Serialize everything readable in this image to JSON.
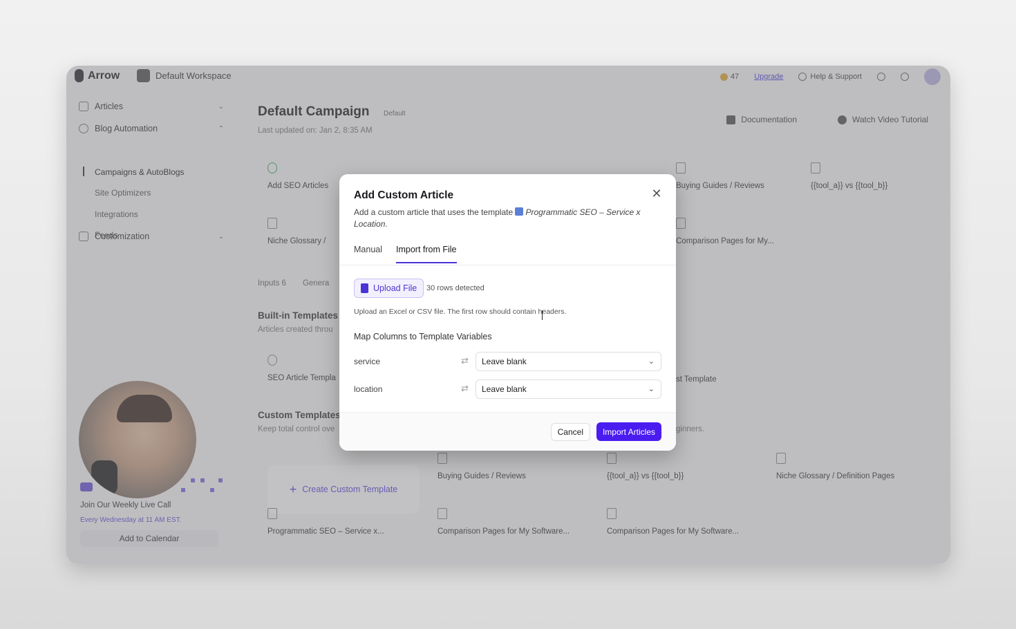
{
  "app": {
    "brand": "Arrow",
    "workspace": "Default Workspace",
    "credits": "47",
    "upgrade_label": "Upgrade",
    "help_label": "Help & Support"
  },
  "sidebar": {
    "items": [
      {
        "label": "Articles"
      },
      {
        "label": "Blog Automation"
      },
      {
        "label": "Customization"
      }
    ],
    "subitems": [
      {
        "label": "Campaigns & AutoBlogs"
      },
      {
        "label": "Site Optimizers"
      },
      {
        "label": "Integrations"
      },
      {
        "label": "Feeds"
      }
    ],
    "live": {
      "title": "Join Our Weekly Live Call",
      "subtitle": "Every Wednesday at 11 AM EST.",
      "button": "Add to Calendar"
    }
  },
  "main": {
    "title": "Default Campaign",
    "badge": "Default",
    "updated": "Last updated on: Jan 2, 8:35 AM",
    "documentation": "Documentation",
    "video_tutorial": "Watch Video Tutorial",
    "top_cards": [
      "Add SEO Articles",
      "Buying Guides / Reviews",
      "{{tool_a}} vs {{tool_b}}",
      "Niche Glossary /",
      "Comparison Pages for My..."
    ],
    "tabs": [
      "Inputs",
      "6",
      "Genera"
    ],
    "builtin_title": "Built-in Templates",
    "builtin_sub": "Articles created throu",
    "builtin_cards": [
      "SEO Article Templa",
      "st Template"
    ],
    "custom_title": "Custom Templates",
    "custom_sub": "Keep total control ove",
    "custom_sub_right": "ginners.",
    "create_template": "Create Custom Template",
    "custom_cards": [
      "Buying Guides / Reviews",
      "{{tool_a}} vs {{tool_b}}",
      "Niche Glossary / Definition Pages",
      "Programmatic SEO – Service x...",
      "Comparison Pages for My Software...",
      "Comparison Pages for My Software..."
    ]
  },
  "modal": {
    "title": "Add Custom Article",
    "desc_prefix": "Add a custom article that uses the template",
    "template_name": "Programmatic SEO – Service x Location",
    "desc_suffix": ".",
    "tabs": [
      "Manual",
      "Import from File"
    ],
    "active_tab": "Import from File",
    "upload_label": "Upload File",
    "rows_detected": "30 rows detected",
    "upload_help": "Upload an Excel or CSV file. The first row should contain headers.",
    "map_heading": "Map Columns to Template Variables",
    "mappings": [
      {
        "variable": "service",
        "value": "Leave blank"
      },
      {
        "variable": "location",
        "value": "Leave blank"
      }
    ],
    "cancel_label": "Cancel",
    "import_label": "Import Articles"
  },
  "colors": {
    "accent": "#4a1cf0",
    "accent_soft": "#f3f0fe"
  }
}
